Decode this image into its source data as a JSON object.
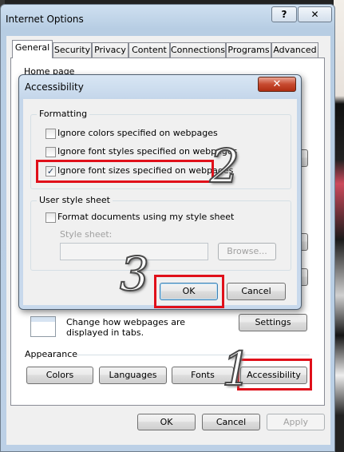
{
  "main": {
    "title": "Internet Options",
    "help_glyph": "?",
    "close_glyph": "✕",
    "tabs": [
      "General",
      "Security",
      "Privacy",
      "Content",
      "Connections",
      "Programs",
      "Advanced"
    ],
    "home_page_label": "Home page",
    "tabs_description": "Change how webpages are displayed in tabs.",
    "tabs_settings_label": "Settings",
    "appearance_label": "Appearance",
    "colors_label": "Colors",
    "languages_label": "Languages",
    "fonts_label": "Fonts",
    "accessibility_label": "Accessibility",
    "ok_label": "OK",
    "cancel_label": "Cancel",
    "apply_label": "Apply"
  },
  "acc": {
    "title": "Accessibility",
    "close_glyph": "✕",
    "formatting_label": "Formatting",
    "ignore_colors": {
      "label": "Ignore colors specified on webpages",
      "checked": false
    },
    "ignore_font_styles": {
      "label": "Ignore font styles specified on webpages",
      "checked": false
    },
    "ignore_font_sizes": {
      "label": "Ignore font sizes specified on webpages",
      "checked": true
    },
    "user_style_label": "User style sheet",
    "format_documents": {
      "label": "Format documents using my style sheet",
      "checked": false
    },
    "style_sheet_label": "Style sheet:",
    "style_sheet_value": "",
    "browse_label": "Browse...",
    "ok_label": "OK",
    "cancel_label": "Cancel",
    "check_glyph": "✓"
  },
  "annotations": {
    "step1": "1",
    "step2": "2",
    "step3": "3"
  },
  "colors": {
    "highlight": "#e0101a",
    "close_red": "#c74a2f"
  }
}
